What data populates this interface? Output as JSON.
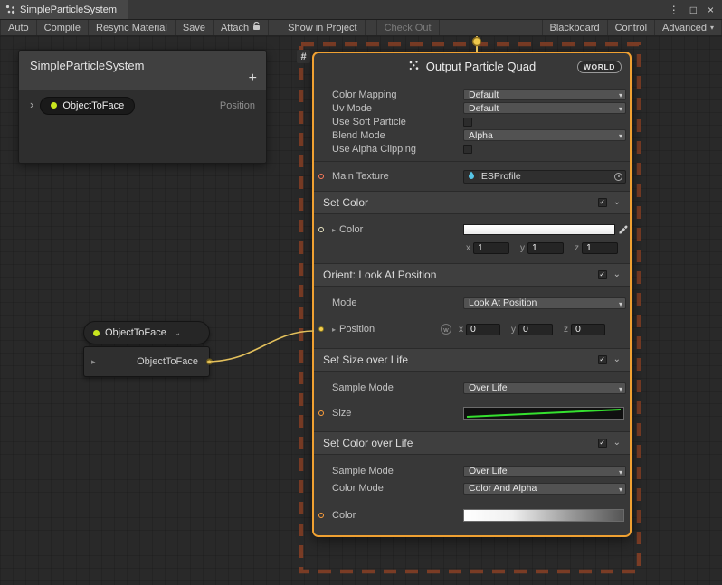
{
  "window": {
    "tab_title": "SimpleParticleSystem"
  },
  "toolbar": {
    "auto": "Auto",
    "compile": "Compile",
    "resync_material": "Resync Material",
    "save": "Save",
    "attach": "Attach",
    "show_in_project": "Show in Project",
    "check_out": "Check Out",
    "blackboard": "Blackboard",
    "control": "Control",
    "advanced": "Advanced"
  },
  "blackboard": {
    "title": "SimpleParticleSystem",
    "add_label": "+",
    "item": {
      "name": "ObjectToFace",
      "type": "Position"
    }
  },
  "param_node": {
    "title": "ObjectToFace",
    "output_label": "ObjectToFace"
  },
  "system": {
    "hash_label": "#"
  },
  "output_node": {
    "title": "Output Particle Quad",
    "space_badge": "WORLD",
    "settings": [
      {
        "label": "Color Mapping",
        "value": "Default"
      },
      {
        "label": "Uv Mode",
        "value": "Default"
      },
      {
        "label": "Use Soft Particle"
      },
      {
        "label": "Blend Mode",
        "value": "Alpha"
      },
      {
        "label": "Use Alpha Clipping"
      }
    ],
    "main_texture": {
      "label": "Main Texture",
      "value": "IESProfile"
    },
    "set_color": {
      "title": "Set Color",
      "color_label": "Color",
      "fields": [
        {
          "axis": "x",
          "value": "1"
        },
        {
          "axis": "y",
          "value": "1"
        },
        {
          "axis": "z",
          "value": "1"
        }
      ]
    },
    "orient": {
      "title": "Orient: Look At Position",
      "mode_label": "Mode",
      "mode_value": "Look At Position",
      "position_label": "Position",
      "space_toggle": "w",
      "fields": [
        {
          "axis": "x",
          "value": "0"
        },
        {
          "axis": "y",
          "value": "0"
        },
        {
          "axis": "z",
          "value": "0"
        }
      ]
    },
    "set_size": {
      "title": "Set Size over Life",
      "sample_mode_label": "Sample Mode",
      "sample_mode_value": "Over Life",
      "size_label": "Size"
    },
    "set_color_over_life": {
      "title": "Set Color over Life",
      "sample_mode_label": "Sample Mode",
      "sample_mode_value": "Over Life",
      "color_mode_label": "Color Mode",
      "color_mode_value": "Color And Alpha",
      "color_label": "Color"
    }
  },
  "icons": {
    "kebab": "⋮",
    "maximize": "□",
    "close": "×",
    "caret": "▾",
    "collapse": "⌄",
    "expander": "▸",
    "row_expander": "›",
    "check": "✓"
  },
  "colors": {
    "selection_border": "#F0A132",
    "flow_edge": "#E3C05C",
    "system_dashed_border": "#7A3C25",
    "size_curve": "#35E02F",
    "parameter_dot": "#C8E61E",
    "texture_port": "#FF7B5A",
    "vector_port": "#F5CE4E"
  }
}
